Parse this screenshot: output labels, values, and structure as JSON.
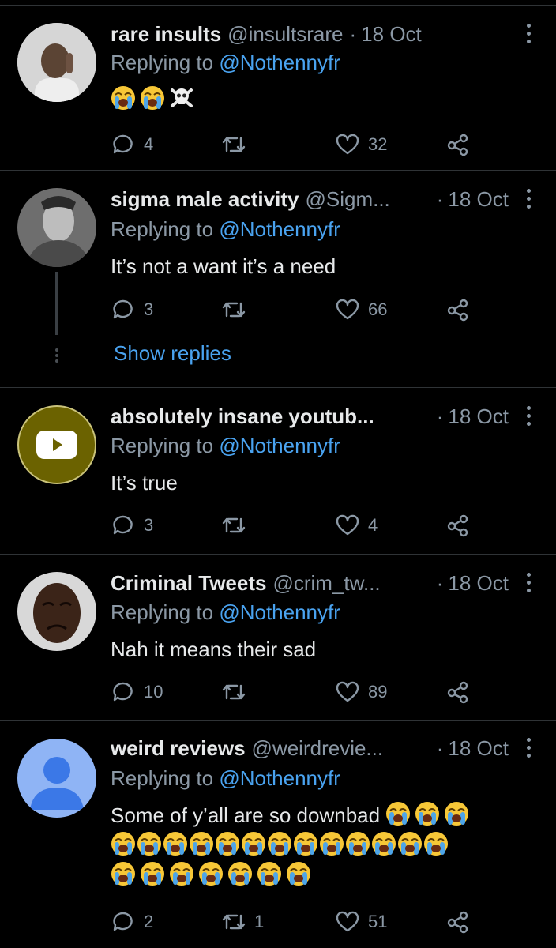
{
  "tweets": [
    {
      "name": "rare insults",
      "handle": "@insultsrare",
      "dot": "·",
      "date": "18 Oct",
      "replying_prefix": "Replying to",
      "replying_to": "@Nothennyfr",
      "text": "",
      "reply_count": "4",
      "retweet_count": "",
      "like_count": "32",
      "avatar": "man-avatar"
    },
    {
      "name": "sigma male activity",
      "handle": "@Sigm...",
      "dot": "·",
      "date": "18 Oct",
      "replying_prefix": "Replying to",
      "replying_to": "@Nothennyfr",
      "text": "It’s not a want it’s a need",
      "reply_count": "3",
      "retweet_count": "",
      "like_count": "66",
      "show_replies": "Show replies",
      "avatar": "gigachad-avatar"
    },
    {
      "name": "absolutely insane youtub...",
      "handle": "",
      "dot": "·",
      "date": "18 Oct",
      "replying_prefix": "Replying to",
      "replying_to": "@Nothennyfr",
      "text": "It’s true",
      "reply_count": "3",
      "retweet_count": "",
      "like_count": "4",
      "avatar": "youtube-play-avatar"
    },
    {
      "name": "Criminal Tweets",
      "handle": "@crim_tw...",
      "dot": "·",
      "date": "18 Oct",
      "replying_prefix": "Replying to",
      "replying_to": "@Nothennyfr",
      "text": "Nah it means their sad",
      "reply_count": "10",
      "retweet_count": "",
      "like_count": "89",
      "avatar": "crying-man-avatar"
    },
    {
      "name": "weird reviews",
      "handle": "@weirdrevie...",
      "dot": "·",
      "date": "18 Oct",
      "replying_prefix": "Replying to",
      "replying_to": "@Nothennyfr",
      "text": "Some of y’all are so downbad",
      "reply_count": "2",
      "retweet_count": "1",
      "like_count": "51",
      "avatar": "default-person-avatar"
    }
  ],
  "emojis": {
    "tweet1": [
      "loudly-crying-face",
      "loudly-crying-face",
      "skull-and-crossbones"
    ],
    "tweet5_line1_count": 3,
    "tweet5_line2_count": 13,
    "tweet5_line3_count": 7
  },
  "colors": {
    "background": "#000000",
    "text": "#e7e9ea",
    "muted": "#8b98a5",
    "link": "#4aa3f0",
    "divider": "#2f3336",
    "youtube_avatar": "#6b6200"
  }
}
